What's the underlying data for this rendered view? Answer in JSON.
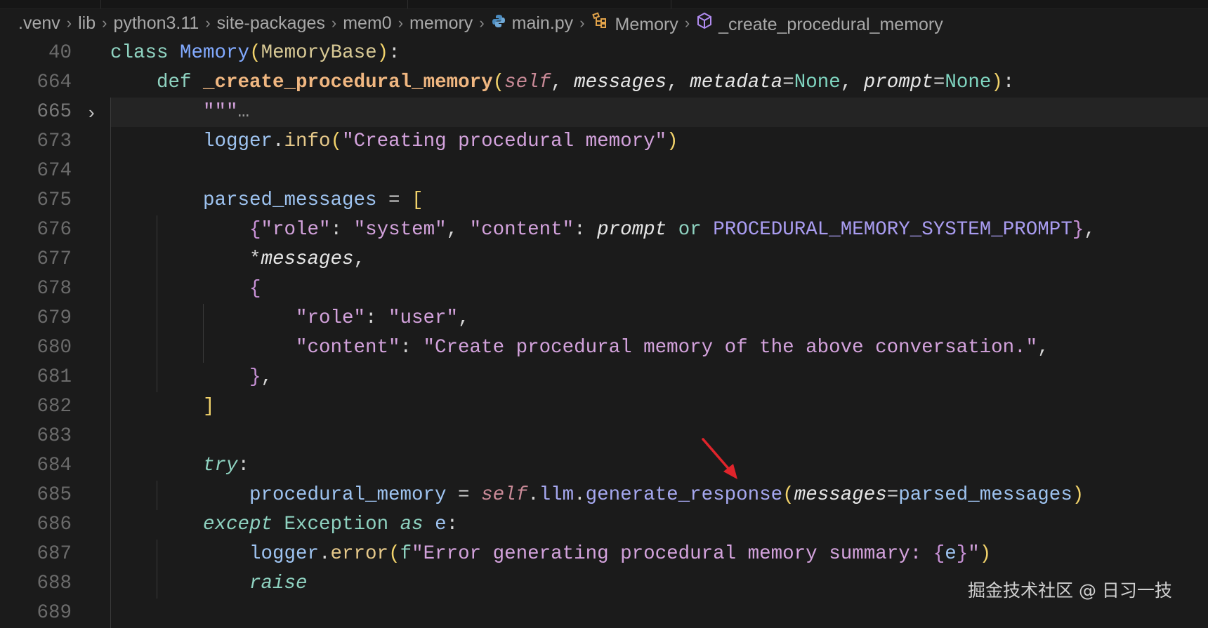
{
  "breadcrumb": {
    "items": [
      ".venv",
      "lib",
      "python3.11",
      "site-packages",
      "mem0",
      "memory",
      "main.py",
      "Memory",
      "_create_procedural_memory"
    ],
    "icons": {
      "main.py": "python-file-icon",
      "Memory": "class-icon",
      "_create_procedural_memory": "method-cube-icon"
    }
  },
  "colors": {
    "background": "#1b1b1b",
    "arrow": "#e0242b"
  },
  "lines": [
    {
      "n": "40",
      "indent": 0,
      "tokens": [
        [
          "class",
          "kw"
        ],
        [
          " ",
          "pl"
        ],
        [
          "Memory",
          "cls"
        ],
        [
          "(",
          "par"
        ],
        [
          "MemoryBase",
          "base"
        ],
        [
          ")",
          "par"
        ],
        [
          ":",
          "pl"
        ]
      ]
    },
    {
      "n": "664",
      "indent": 1,
      "tokens": [
        [
          "def",
          "kw"
        ],
        [
          " ",
          "pl"
        ],
        [
          "_create_procedural_memory",
          "fn"
        ],
        [
          "(",
          "par"
        ],
        [
          "self",
          "self"
        ],
        [
          ", ",
          "pl"
        ],
        [
          "messages",
          "param"
        ],
        [
          ", ",
          "pl"
        ],
        [
          "metadata",
          "param"
        ],
        [
          "=",
          "pl"
        ],
        [
          "None",
          "none"
        ],
        [
          ", ",
          "pl"
        ],
        [
          "prompt",
          "param"
        ],
        [
          "=",
          "pl"
        ],
        [
          "None",
          "none"
        ],
        [
          ")",
          "par"
        ],
        [
          ":",
          "pl"
        ]
      ]
    },
    {
      "n": "665",
      "indent": 2,
      "folded": true,
      "highlight": true,
      "tokens": [
        [
          "\"\"\"",
          "str"
        ],
        [
          "…",
          "dim"
        ]
      ]
    },
    {
      "n": "673",
      "indent": 2,
      "tokens": [
        [
          "logger",
          "var"
        ],
        [
          ".",
          "pl"
        ],
        [
          "info",
          "meth"
        ],
        [
          "(",
          "par"
        ],
        [
          "\"Creating procedural memory\"",
          "str"
        ],
        [
          ")",
          "par"
        ]
      ]
    },
    {
      "n": "674",
      "indent": 2,
      "tokens": []
    },
    {
      "n": "675",
      "indent": 2,
      "tokens": [
        [
          "parsed_messages",
          "var"
        ],
        [
          " = ",
          "pl"
        ],
        [
          "[",
          "par"
        ]
      ]
    },
    {
      "n": "676",
      "indent": 3,
      "tokens": [
        [
          "{",
          "brk"
        ],
        [
          "\"role\"",
          "str"
        ],
        [
          ": ",
          "pl"
        ],
        [
          "\"system\"",
          "str"
        ],
        [
          ", ",
          "pl"
        ],
        [
          "\"content\"",
          "str"
        ],
        [
          ": ",
          "pl"
        ],
        [
          "prompt",
          "param"
        ],
        [
          " ",
          "pl"
        ],
        [
          "or",
          "kw"
        ],
        [
          " ",
          "pl"
        ],
        [
          "PROCEDURAL_MEMORY_SYSTEM_PROMPT",
          "const"
        ],
        [
          "}",
          "brk"
        ],
        [
          ",",
          "pl"
        ]
      ]
    },
    {
      "n": "677",
      "indent": 3,
      "tokens": [
        [
          "*",
          "pl"
        ],
        [
          "messages",
          "param"
        ],
        [
          ",",
          "pl"
        ]
      ]
    },
    {
      "n": "678",
      "indent": 3,
      "tokens": [
        [
          "{",
          "brk"
        ]
      ]
    },
    {
      "n": "679",
      "indent": 4,
      "tokens": [
        [
          "\"role\"",
          "str"
        ],
        [
          ": ",
          "pl"
        ],
        [
          "\"user\"",
          "str"
        ],
        [
          ",",
          "pl"
        ]
      ]
    },
    {
      "n": "680",
      "indent": 4,
      "tokens": [
        [
          "\"content\"",
          "str"
        ],
        [
          ": ",
          "pl"
        ],
        [
          "\"Create procedural memory of the above conversation.\"",
          "str"
        ],
        [
          ",",
          "pl"
        ]
      ]
    },
    {
      "n": "681",
      "indent": 3,
      "tokens": [
        [
          "}",
          "brk"
        ],
        [
          ",",
          "pl"
        ]
      ]
    },
    {
      "n": "682",
      "indent": 2,
      "tokens": [
        [
          "]",
          "par"
        ]
      ]
    },
    {
      "n": "683",
      "indent": 2,
      "tokens": []
    },
    {
      "n": "684",
      "indent": 2,
      "tokens": [
        [
          "try",
          "ctl"
        ],
        [
          ":",
          "pl"
        ]
      ]
    },
    {
      "n": "685",
      "indent": 3,
      "tokens": [
        [
          "procedural_memory",
          "var"
        ],
        [
          " = ",
          "pl"
        ],
        [
          "self",
          "self"
        ],
        [
          ".",
          "pl"
        ],
        [
          "llm",
          "gen"
        ],
        [
          ".",
          "pl"
        ],
        [
          "generate_response",
          "gen"
        ],
        [
          "(",
          "par"
        ],
        [
          "messages",
          "param"
        ],
        [
          "=",
          "pl"
        ],
        [
          "parsed_messages",
          "var"
        ],
        [
          ")",
          "par"
        ]
      ]
    },
    {
      "n": "686",
      "indent": 2,
      "tokens": [
        [
          "except",
          "ctl"
        ],
        [
          " ",
          "pl"
        ],
        [
          "Exception",
          "exc"
        ],
        [
          " ",
          "pl"
        ],
        [
          "as",
          "ctl"
        ],
        [
          " ",
          "pl"
        ],
        [
          "e",
          "var"
        ],
        [
          ":",
          "pl"
        ]
      ]
    },
    {
      "n": "687",
      "indent": 3,
      "tokens": [
        [
          "logger",
          "var"
        ],
        [
          ".",
          "pl"
        ],
        [
          "error",
          "meth"
        ],
        [
          "(",
          "par"
        ],
        [
          "f",
          "kw"
        ],
        [
          "\"Error generating procedural memory summary: ",
          "str"
        ],
        [
          "{",
          "brk"
        ],
        [
          "e",
          "var"
        ],
        [
          "}",
          "brk"
        ],
        [
          "\"",
          "str"
        ],
        [
          ")",
          "par"
        ]
      ]
    },
    {
      "n": "688",
      "indent": 3,
      "tokens": [
        [
          "raise",
          "ctl"
        ]
      ]
    },
    {
      "n": "689",
      "indent": 2,
      "tokens": []
    }
  ],
  "watermark": "掘金技术社区 @ 日习一技"
}
